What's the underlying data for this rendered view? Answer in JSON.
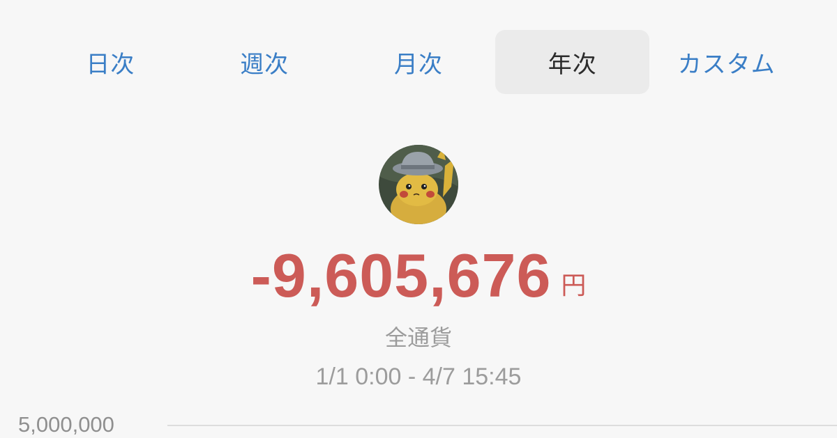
{
  "tabs": [
    {
      "label": "日次",
      "active": false
    },
    {
      "label": "週次",
      "active": false
    },
    {
      "label": "月次",
      "active": false
    },
    {
      "label": "年次",
      "active": true
    },
    {
      "label": "カスタム",
      "active": false
    }
  ],
  "summary": {
    "amount": "-9,605,676",
    "unit": "円",
    "scope": "全通貨",
    "period": "1/1 0:00 - 4/7 15:45"
  },
  "chart": {
    "y_tick_top": "5,000,000"
  },
  "colors": {
    "accent": "#3a7ec6",
    "loss": "#cc5b57",
    "muted": "#9c9c9c"
  }
}
